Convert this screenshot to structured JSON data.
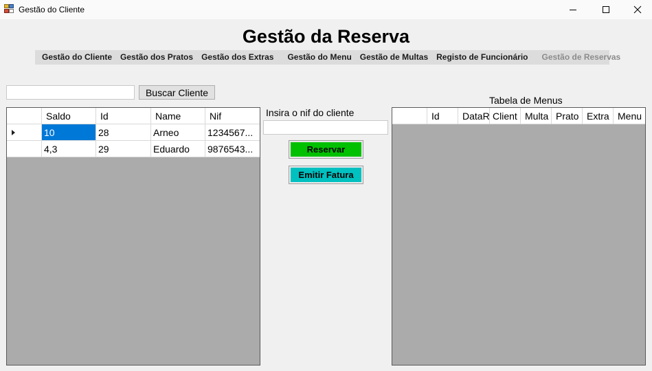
{
  "window": {
    "title": "Gestão do Cliente"
  },
  "page": {
    "title": "Gestão da Reserva"
  },
  "menu": {
    "items": [
      {
        "label": "Gestão do Cliente"
      },
      {
        "label": "Gestão dos Pratos"
      },
      {
        "label": "Gestão dos Extras"
      },
      {
        "label": "Gestão do Menu"
      },
      {
        "label": "Gestão de Multas"
      },
      {
        "label": "Registo de Funcionário"
      },
      {
        "label": "Gestão de Reservas"
      }
    ]
  },
  "search": {
    "value": "",
    "button_label": "Buscar Cliente"
  },
  "clients_grid": {
    "columns": [
      "Saldo",
      "Id",
      "Name",
      "Nif"
    ],
    "rows": [
      {
        "saldo": "10",
        "id": "28",
        "name": "Arneo",
        "nif": "1234567..."
      },
      {
        "saldo": "4,3",
        "id": "29",
        "name": "Eduardo",
        "nif": "9876543..."
      }
    ]
  },
  "nif": {
    "label": "Insira o nif do cliente",
    "value": ""
  },
  "actions": {
    "reservar_label": "Reservar",
    "fatura_label": "Emitir Fatura",
    "reservar_color": "#00c000",
    "fatura_color": "#00c0c0"
  },
  "menus_grid": {
    "title": "Tabela de Menus",
    "columns": [
      "Id",
      "DataR",
      "Client",
      "Multa",
      "Prato",
      "Extra",
      "Menu"
    ]
  }
}
